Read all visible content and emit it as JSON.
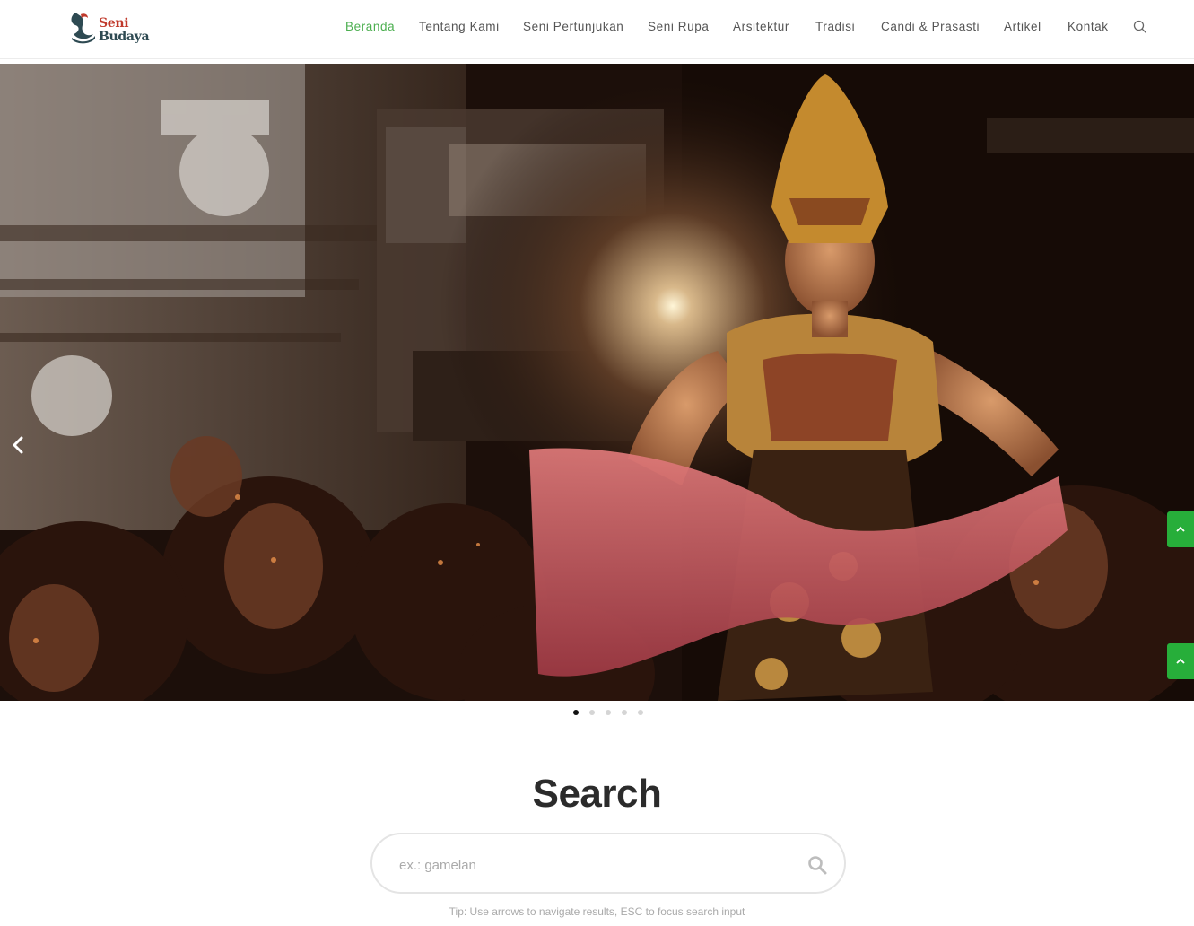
{
  "header": {
    "logo": {
      "line1": "Seni",
      "line2": "Budaya"
    },
    "nav": [
      {
        "label": "Beranda",
        "active": true
      },
      {
        "label": "Tentang Kami",
        "active": false
      },
      {
        "label": "Seni Pertunjukan",
        "active": false
      },
      {
        "label": "Seni Rupa",
        "active": false
      },
      {
        "label": "Arsitektur",
        "active": false
      },
      {
        "label": "Tradisi",
        "active": false
      },
      {
        "label": "Candi & Prasasti",
        "active": false
      },
      {
        "label": "Artikel",
        "active": false
      },
      {
        "label": "Kontak",
        "active": false
      }
    ],
    "search_icon": "search-icon"
  },
  "hero": {
    "prev_icon": "chevron-left-icon",
    "side_buttons": [
      "chevron-up-icon",
      "chevron-up-icon"
    ],
    "slide_count": 5,
    "active_slide": 1
  },
  "search": {
    "title": "Search",
    "placeholder": "ex.: gamelan",
    "value": "",
    "submit_icon": "search-icon",
    "tip": "Tip: Use arrows to navigate results, ESC to focus search input"
  },
  "colors": {
    "accent": "#4caf50",
    "side_button": "#27ae3a",
    "logo_red": "#c0392b",
    "logo_dark": "#2e4a52"
  }
}
